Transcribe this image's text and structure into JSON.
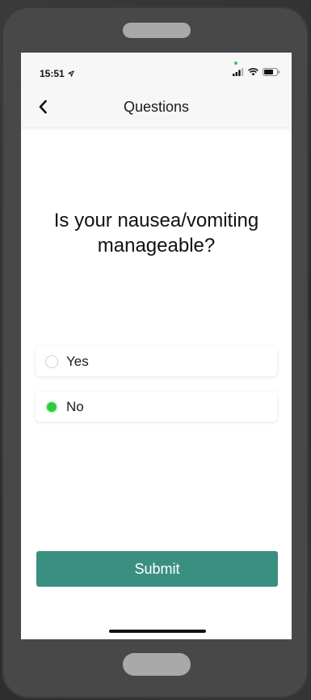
{
  "status_bar": {
    "time": "15:51",
    "location_icon": "location-arrow-icon",
    "signal_icon": "signal-icon",
    "wifi_icon": "wifi-icon",
    "battery_icon": "battery-icon"
  },
  "nav": {
    "back_icon": "chevron-left-icon",
    "title": "Questions"
  },
  "question": {
    "text": "Is your nausea/vomiting manageable?"
  },
  "options": [
    {
      "label": "Yes",
      "selected": false
    },
    {
      "label": "No",
      "selected": true
    }
  ],
  "submit": {
    "label": "Submit"
  },
  "colors": {
    "accent": "#3a9080",
    "radio_selected": "#2fcb3f"
  }
}
